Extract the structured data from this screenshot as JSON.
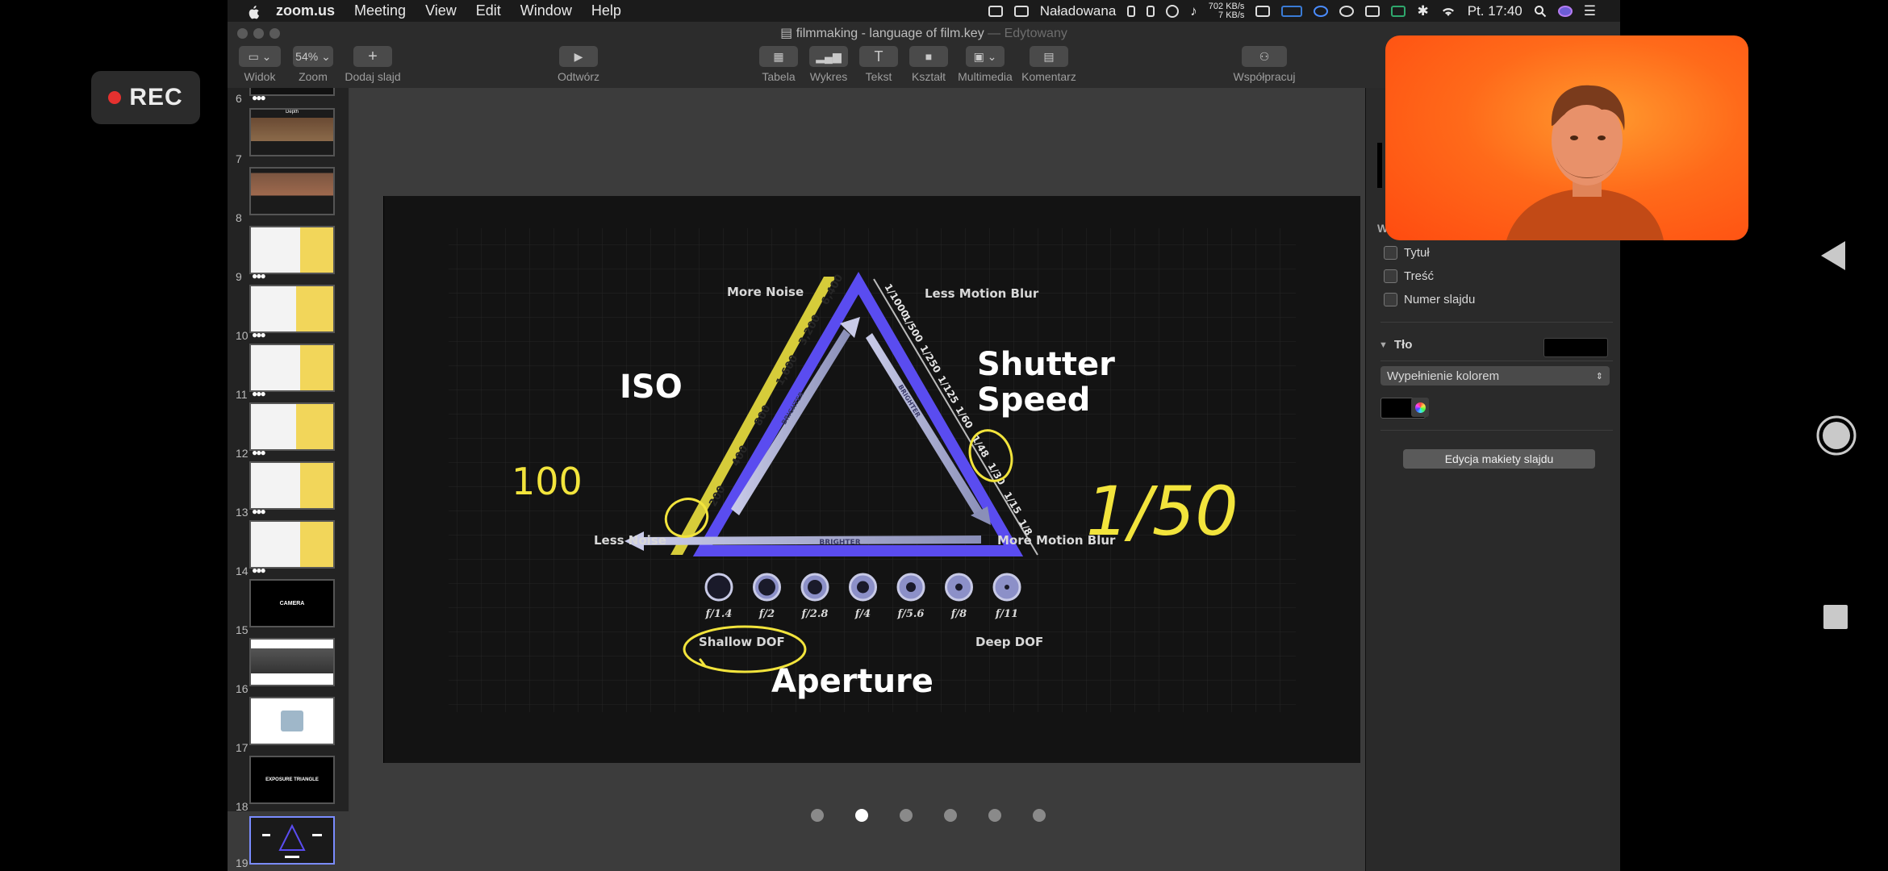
{
  "recording": {
    "label": "REC"
  },
  "menubar": {
    "app": "zoom.us",
    "items": [
      "Meeting",
      "View",
      "Edit",
      "Window",
      "Help"
    ],
    "battery": "Naładowana",
    "net_up": "702 KB/s",
    "net_down": "7 KB/s",
    "clock": "Pt. 17:40"
  },
  "window": {
    "title": "filmmaking - language of film.key",
    "status": "— Edytowany"
  },
  "toolbar": {
    "view_label": "Widok",
    "zoom_value": "54%",
    "zoom_label": "Zoom",
    "add_slide_label": "Dodaj slajd",
    "play_label": "Odtwórz",
    "table_label": "Tabela",
    "chart_label": "Wykres",
    "text_label": "Tekst",
    "shape_label": "Kształt",
    "media_label": "Multimedia",
    "comment_label": "Komentarz",
    "collab_label": "Współpracuj"
  },
  "navigator": {
    "slides": [
      {
        "num": "6"
      },
      {
        "num": "7"
      },
      {
        "num": "8"
      },
      {
        "num": "9"
      },
      {
        "num": "10"
      },
      {
        "num": "11"
      },
      {
        "num": "12"
      },
      {
        "num": "13"
      },
      {
        "num": "14"
      },
      {
        "num": "15",
        "caption": "CAMERA"
      },
      {
        "num": "16"
      },
      {
        "num": "17"
      },
      {
        "num": "18",
        "caption": "EXPOSURE TRIANGLE"
      },
      {
        "num": "19"
      }
    ],
    "thumb7_caption": "Depth",
    "selected": "19"
  },
  "slide": {
    "iso_title": "ISO",
    "shutter_title_1": "Shutter",
    "shutter_title_2": "Speed",
    "aperture_title": "Aperture",
    "more_noise": "More Noise",
    "less_noise": "Less Noise",
    "less_motion_blur": "Less Motion Blur",
    "more_motion_blur": "More Motion Blur",
    "shallow_dof": "Shallow DOF",
    "deep_dof": "Deep DOF",
    "brighter": "BRIGHTER",
    "iso_values": [
      "200",
      "400",
      "800",
      "1,600",
      "3,200",
      "6,400"
    ],
    "shutter_values": [
      "1/1000",
      "1/500",
      "1/250",
      "1/125",
      "1/60",
      "1/48",
      "1/30",
      "1/15",
      "1/8"
    ],
    "fstops": [
      "f/1.4",
      "f/2",
      "f/2.8",
      "f/4",
      "f/5.6",
      "f/8",
      "f/11"
    ],
    "handwriting_iso": "100",
    "handwriting_shutter": "1/50",
    "page_dots": 6,
    "page_active": 2
  },
  "inspector": {
    "title_check": "Tytuł",
    "body_check": "Treść",
    "slide_number_check": "Numer slajdu",
    "background_label": "Tło",
    "fill_select": "Wypełnienie kolorem",
    "edit_layout_btn": "Edycja makiety slajdu",
    "partial_header": "W"
  },
  "colors": {
    "triangle_blue": "#5a4cf0",
    "iso_yellow": "#d6cc3a",
    "annotation_yellow": "#f2e43c"
  }
}
